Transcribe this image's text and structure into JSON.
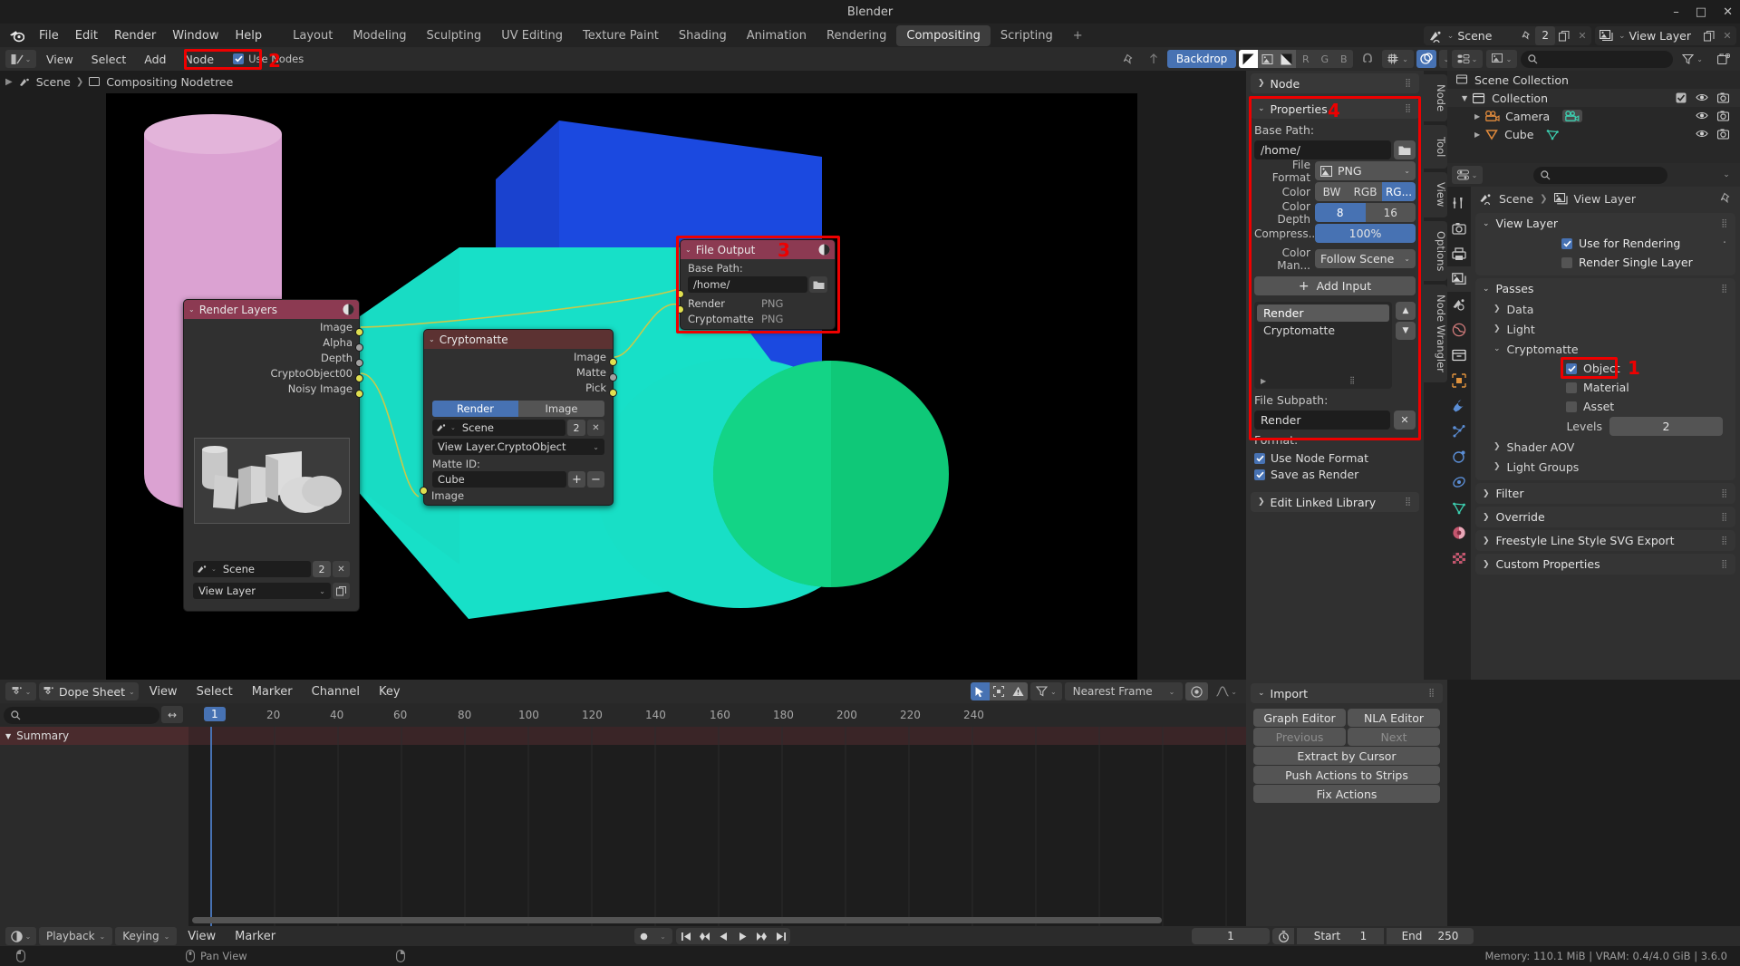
{
  "window": {
    "title": "Blender",
    "minimize": "–",
    "maximize": "□",
    "close": "✕"
  },
  "topbar": {
    "menus": [
      "File",
      "Edit",
      "Render",
      "Window",
      "Help"
    ],
    "workspaces": [
      "Layout",
      "Modeling",
      "Sculpting",
      "UV Editing",
      "Texture Paint",
      "Shading",
      "Animation",
      "Rendering",
      "Compositing",
      "Scripting",
      "+"
    ],
    "active_workspace": "Compositing",
    "scene_name": "Scene",
    "scene_users": "2",
    "view_layer_name": "View Layer"
  },
  "node_header": {
    "menus": [
      "View",
      "Select",
      "Add",
      "Node"
    ],
    "use_nodes_label": "Use Nodes",
    "use_nodes_checked": true,
    "backdrop_label": "Backdrop",
    "channel_r": "R",
    "channel_g": "G",
    "channel_b": "B"
  },
  "breadcrumb": {
    "scene": "Scene",
    "tree": "Compositing Nodetree"
  },
  "nodes": {
    "render_layers": {
      "title": "Render Layers",
      "outputs": [
        "Image",
        "Alpha",
        "Depth",
        "CryptoObject00",
        "Noisy Image"
      ],
      "scene": "Scene",
      "scene_users": "2",
      "layer": "View Layer"
    },
    "cryptomatte": {
      "title": "Cryptomatte",
      "outputs": [
        "Image",
        "Matte",
        "Pick"
      ],
      "source_render": "Render",
      "source_image": "Image",
      "scene": "Scene",
      "scene_users": "2",
      "layer": "View Layer.CryptoObject",
      "matte_id_label": "Matte ID:",
      "matte_id": "Cube",
      "input": "Image"
    },
    "file_output": {
      "title": "File Output",
      "base_path_label": "Base Path:",
      "base_path": "/home/",
      "inputs": [
        {
          "name": "Render",
          "format": "PNG"
        },
        {
          "name": "Cryptomatte",
          "format": "PNG"
        }
      ]
    }
  },
  "node_sidebar": {
    "tabs": [
      "Node",
      "Tool",
      "View",
      "Options",
      "Node Wrangler"
    ],
    "node_panel": "Node",
    "properties_panel": "Properties",
    "base_path_label": "Base Path:",
    "base_path": "/home/",
    "file_format_label": "File Format",
    "file_format": "PNG",
    "color_label": "Color",
    "color_options": [
      "BW",
      "RGB",
      "RG..."
    ],
    "color_selected": "RG...",
    "color_depth_label": "Color Depth",
    "color_depth_options": [
      "8",
      "16"
    ],
    "color_depth_selected": "8",
    "compression_label": "Compress...",
    "compression_value": "100%",
    "color_management_label": "Color Man...",
    "color_management_value": "Follow Scene",
    "add_input_label": "Add Input",
    "inputs": [
      "Render",
      "Cryptomatte"
    ],
    "input_selected": "Render",
    "file_subpath_label": "File Subpath:",
    "file_subpath": "Render",
    "format_label": "Format:",
    "use_node_format_label": "Use Node Format",
    "use_node_format": true,
    "save_as_render_label": "Save as Render",
    "save_as_render": true,
    "edit_linked_library": "Edit Linked Library"
  },
  "outliner": {
    "root": "Scene Collection",
    "items": [
      {
        "name": "Collection",
        "indent": 1,
        "expanded": true,
        "icon": "collection-icon"
      },
      {
        "name": "Camera",
        "indent": 2,
        "expanded": false,
        "icon": "camera-icon"
      },
      {
        "name": "Cube",
        "indent": 2,
        "expanded": false,
        "icon": "mesh-icon"
      }
    ]
  },
  "properties": {
    "breadcrumb_scene": "Scene",
    "breadcrumb_viewlayer": "View Layer",
    "view_layer_panel": "View Layer",
    "use_for_rendering_label": "Use for Rendering",
    "use_for_rendering": true,
    "render_single_layer_label": "Render Single Layer",
    "render_single_layer": false,
    "passes_panel": "Passes",
    "data_sub": "Data",
    "light_sub": "Light",
    "cryptomatte_sub": "Cryptomatte",
    "object_label": "Object",
    "object_checked": true,
    "material_label": "Material",
    "material_checked": false,
    "asset_label": "Asset",
    "asset_checked": false,
    "levels_label": "Levels",
    "levels_value": "2",
    "shader_aov": "Shader AOV",
    "light_groups": "Light Groups",
    "filter_panel": "Filter",
    "override_panel": "Override",
    "freestyle_panel": "Freestyle Line Style SVG Export",
    "custom_props_panel": "Custom Properties"
  },
  "dopesheet": {
    "editor_name": "Dope Sheet",
    "menus": [
      "View",
      "Select",
      "Marker",
      "Channel",
      "Key"
    ],
    "summary_label": "Summary",
    "current_frame": "1",
    "ruler_ticks": [
      "1",
      "20",
      "40",
      "60",
      "80",
      "100",
      "120",
      "140",
      "160",
      "180",
      "200",
      "220",
      "240"
    ],
    "snap_mode": "Nearest Frame"
  },
  "timeline_panel": {
    "import_panel": "Import",
    "graph_editor": "Graph Editor",
    "nla_editor": "NLA Editor",
    "previous": "Previous",
    "next": "Next",
    "extract_by_cursor": "Extract by Cursor",
    "push_actions": "Push Actions to Strips",
    "fix_actions": "Fix Actions"
  },
  "playbar": {
    "playback": "Playback",
    "keying": "Keying",
    "view": "View",
    "marker": "Marker",
    "current_frame": "1",
    "start_label": "Start",
    "start_value": "1",
    "end_label": "End",
    "end_value": "250"
  },
  "statusbar": {
    "hint": "Pan View",
    "memory": "Memory: 110.1 MiB | VRAM: 0.4/4.0 GiB | 3.6.0"
  },
  "annotations": {
    "n1": "1",
    "n2": "2",
    "n3": "3",
    "n4": "4"
  },
  "colors": {
    "accent_blue": "#4772b3",
    "annotation_red": "#ee0000",
    "node_render_layers_header": "#8c3a52",
    "node_cryptomatte_header": "#5c3232",
    "node_file_output_header": "#8c3a52"
  }
}
